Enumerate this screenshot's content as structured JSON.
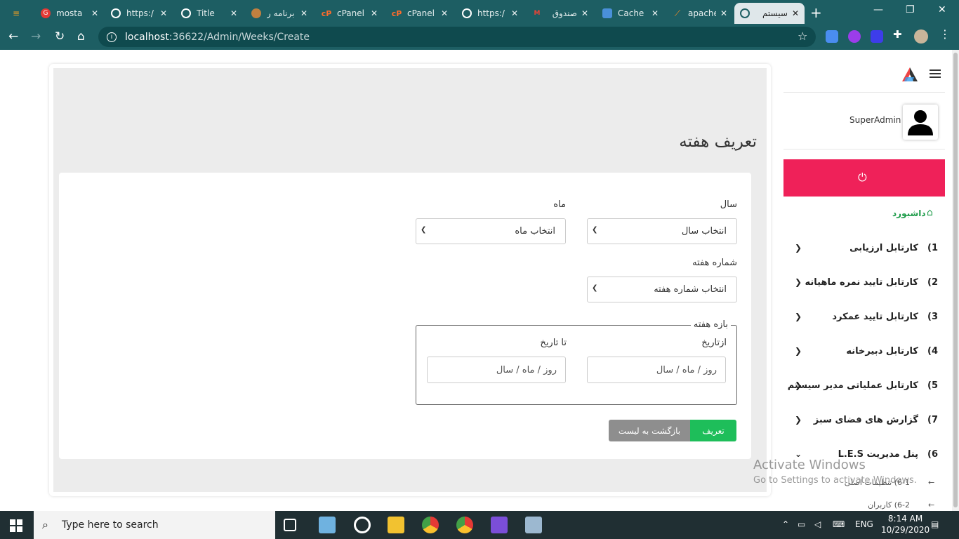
{
  "browser": {
    "tabs": [
      {
        "title": "",
        "icon": "stack-icon",
        "color": "#1d5e63"
      },
      {
        "title": "mosta",
        "icon": "grammarly-icon",
        "color": "#e53935"
      },
      {
        "title": "https:/",
        "icon": "globe-icon",
        "color": "#ffffff"
      },
      {
        "title": "Title",
        "icon": "globe-icon",
        "color": "#ffffff"
      },
      {
        "title": "برنامه ر",
        "icon": "app-icon",
        "color": "#c08040"
      },
      {
        "title": "cPanel",
        "icon": "cpanel-icon",
        "color": "#ff6c2c"
      },
      {
        "title": "cPanel",
        "icon": "cpanel-icon",
        "color": "#ff6c2c"
      },
      {
        "title": "https:/",
        "icon": "globe-icon",
        "color": "#ffffff"
      },
      {
        "title": "صندوق",
        "icon": "gmail-icon",
        "color": "#ea4335"
      },
      {
        "title": "Cache",
        "icon": "cache-icon",
        "color": "#4a90d9"
      },
      {
        "title": "apache",
        "icon": "apache-icon",
        "color": "#c2185b"
      },
      {
        "title": "سیستم",
        "icon": "globe-icon",
        "color": "#1d5e63"
      }
    ],
    "url_host": "localhost",
    "url_path": ":36622/Admin/Weeks/Create"
  },
  "page": {
    "title": "تعریف هفته",
    "form": {
      "year_label": "سال",
      "year_value": "انتخاب سال",
      "month_label": "ماه",
      "month_value": "انتخاب ماه",
      "week_label": "شماره هفته",
      "week_value": "انتخاب شماره هفته",
      "range_legend": "بازه هفته",
      "from_label": "ازتاریخ",
      "to_label": "تا تاریخ",
      "from_placeholder": "روز / ماه / سال",
      "to_placeholder": "روز / ماه / سال",
      "submit_label": "تعریف",
      "back_label": "بازگشت به لیست"
    }
  },
  "sidebar": {
    "username": "SuperAdmin",
    "dashboard": "داشبورد",
    "items": [
      {
        "num": "1)",
        "label": "کارتابل ارزیابی"
      },
      {
        "num": "2)",
        "label": "کارتابل تایید نمره ماهیانه"
      },
      {
        "num": "3)",
        "label": "کارتابل تایید عمکرد"
      },
      {
        "num": "4)",
        "label": "کارتابل دبیرخانه"
      },
      {
        "num": "5)",
        "label": "کارتابل عملیاتی مدیر سیستم"
      },
      {
        "num": "7)",
        "label": "گزارش های فضای سبز"
      },
      {
        "num": "6)",
        "label": "پنل مدیریت L.E.S"
      }
    ],
    "subitems": [
      {
        "label": "6-1) تنظیمات اصلی"
      },
      {
        "label": "6-2) کاربران"
      }
    ]
  },
  "watermark": {
    "line1": "Activate Windows",
    "line2": "Go to Settings to activate Windows."
  },
  "taskbar": {
    "search_placeholder": "Type here to search",
    "lang": "ENG",
    "time": "8:14 AM",
    "date": "10/29/2020"
  },
  "colors": {
    "browser_chrome": "#1d5e63",
    "logout_bg": "#ef2159",
    "submit_bg": "#1ebe5a",
    "back_bg": "#8e8e8e",
    "dashboard_green": "#1e9c4a"
  }
}
